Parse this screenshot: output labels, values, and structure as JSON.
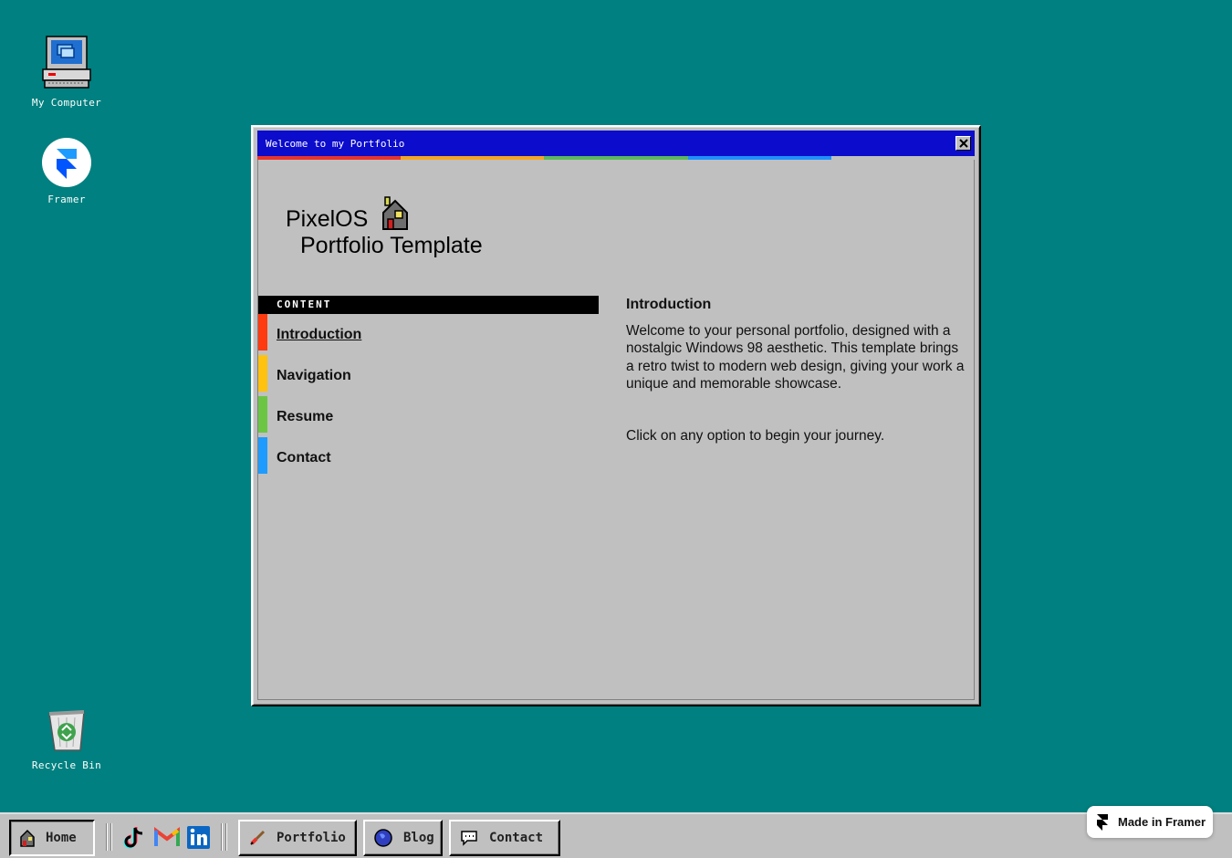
{
  "desktop": {
    "icons": [
      {
        "label": "My Computer",
        "icon": "computer-icon"
      },
      {
        "label": "Framer",
        "icon": "framer-icon"
      },
      {
        "label": "Recycle Bin",
        "icon": "recycle-bin-icon"
      }
    ]
  },
  "window": {
    "title": "Welcome to my Portfolio",
    "stripe_colors": [
      "#e8342c",
      "#f5a623",
      "#5cb85c",
      "#1e90ff",
      "#c0c0c0"
    ],
    "brand_line1": "PixelOS",
    "brand_line2": "Portfolio Template",
    "content_header": "CONTENT",
    "nav": [
      {
        "label": "Introduction",
        "color": "#ff3b0f",
        "active": true
      },
      {
        "label": "Navigation",
        "color": "#ffc20e",
        "active": false
      },
      {
        "label": "Resume",
        "color": "#6cc644",
        "active": false
      },
      {
        "label": "Contact",
        "color": "#1e9bff",
        "active": false
      }
    ],
    "intro": {
      "heading": "Introduction",
      "paragraph1": "Welcome to your personal portfolio, designed with a nostalgic Windows 98 aesthetic. This template brings a retro twist to modern web design, giving your work a unique and memorable showcase.",
      "paragraph2": "Click on any option to begin your journey."
    }
  },
  "taskbar": {
    "home": "Home",
    "portfolio": "Portfolio",
    "blog": "Blog",
    "contact": "Contact",
    "social": [
      "tiktok-icon",
      "gmail-icon",
      "linkedin-icon"
    ]
  },
  "badge": {
    "label": "Made in Framer"
  },
  "colors": {
    "desktop": "#008080",
    "titlebar": "#0c0ccc",
    "window": "#c0c0c0"
  }
}
